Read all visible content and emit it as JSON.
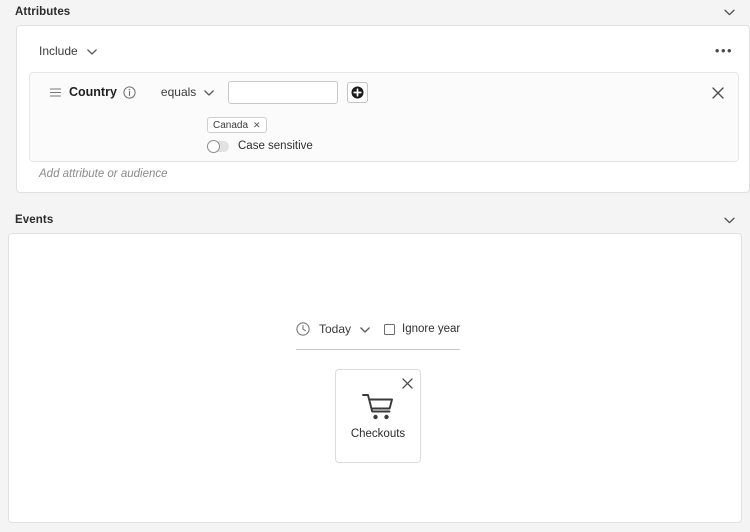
{
  "sections": {
    "attributes": {
      "title": "Attributes",
      "collapse_icon": "chevron-down-icon",
      "scope": {
        "label": "Include",
        "dropdown_icon": "chevron-down-icon"
      },
      "overflow_label": "•••",
      "condition": {
        "drag_icon": "drag-handle-icon",
        "attribute_name": "Country",
        "info_icon": "info-icon",
        "operator": "equals",
        "operator_icon": "chevron-down-icon",
        "value_input": "",
        "value_placeholder": "",
        "add_icon": "plus-circle-icon",
        "remove_icon": "close-icon",
        "tokens": [
          {
            "label": "Canada",
            "remove_icon": "close-icon"
          }
        ],
        "case_sensitive": {
          "label": "Case sensitive",
          "state": "off"
        }
      },
      "add_attribute_placeholder": "Add attribute or audience"
    },
    "events": {
      "title": "Events",
      "collapse_icon": "chevron-down-icon",
      "timeframe": {
        "icon": "clock-icon",
        "label": "Today",
        "dropdown_icon": "chevron-down-icon"
      },
      "ignore_year": {
        "label": "Ignore year",
        "checked": false
      },
      "cards": [
        {
          "label": "Checkouts",
          "icon": "shopping-cart-icon",
          "remove_icon": "close-icon"
        }
      ]
    }
  },
  "colors": {
    "page_background": "#f4f4f4",
    "panel_background": "#ffffff",
    "border": "#e1e1e1",
    "text": "#2c2c2c",
    "muted_text": "#8a8a8a"
  }
}
